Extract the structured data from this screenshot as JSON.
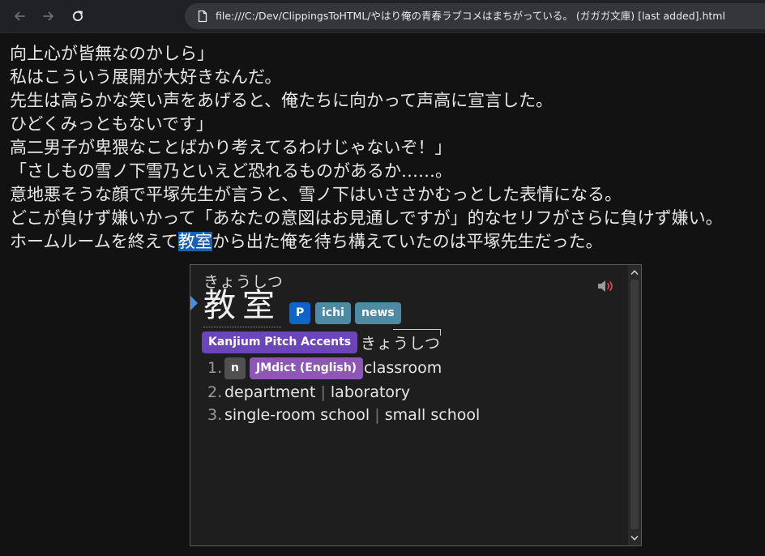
{
  "browser": {
    "url": "file:///C:/Dev/ClippingsToHTML/やはり俺の青春ラブコメはまちがっている。 (ガガガ文庫) [last added].html",
    "icons": [
      "back-arrow-icon",
      "forward-arrow-icon",
      "reload-icon",
      "file-icon"
    ]
  },
  "page": {
    "lines": [
      {
        "text": "向上心が皆無なのかしら」"
      },
      {
        "text": "私はこういう展開が大好きなんだ。"
      },
      {
        "text": "先生は高らかな笑い声をあげると、俺たちに向かって声高に宣言した。"
      },
      {
        "text": "ひどくみっともないです」"
      },
      {
        "text": "高二男子が卑猥なことばかり考えてるわけじゃないぞ！」"
      },
      {
        "text": "「さしもの雪ノ下雪乃といえど恐れるものがあるか……。"
      },
      {
        "text": "意地悪そうな顔で平塚先生が言うと、雪ノ下はいささかむっとした表情になる。"
      },
      {
        "text": "どこが負けず嫌いかって「あなたの意図はお見通しですが」的なセリフがさらに負けず嫌い。"
      },
      {
        "before": "ホームルームを終えて",
        "highlight": "教室",
        "after": "から出た俺を待ち構えていたのは平塚先生だった。"
      }
    ]
  },
  "popup": {
    "reading": "きょうしつ",
    "headword": "教室",
    "tags": {
      "priority": "P",
      "freq1": "ichi",
      "freq2": "news"
    },
    "pitch": {
      "dict_label": "Kanjium Pitch Accents",
      "reading_low": "きょ",
      "reading_high": "うしつ"
    },
    "audio_icon": "speaker-icon",
    "definitions": [
      {
        "num": "1.",
        "pos": "n",
        "dict": "JMdict (English)",
        "gloss": "classroom"
      },
      {
        "num": "2.",
        "gloss_a": "department",
        "sep": "|",
        "gloss_b": "laboratory"
      },
      {
        "num": "3.",
        "gloss_a": "single-room school",
        "sep": "|",
        "gloss_b": "small school"
      }
    ]
  }
}
